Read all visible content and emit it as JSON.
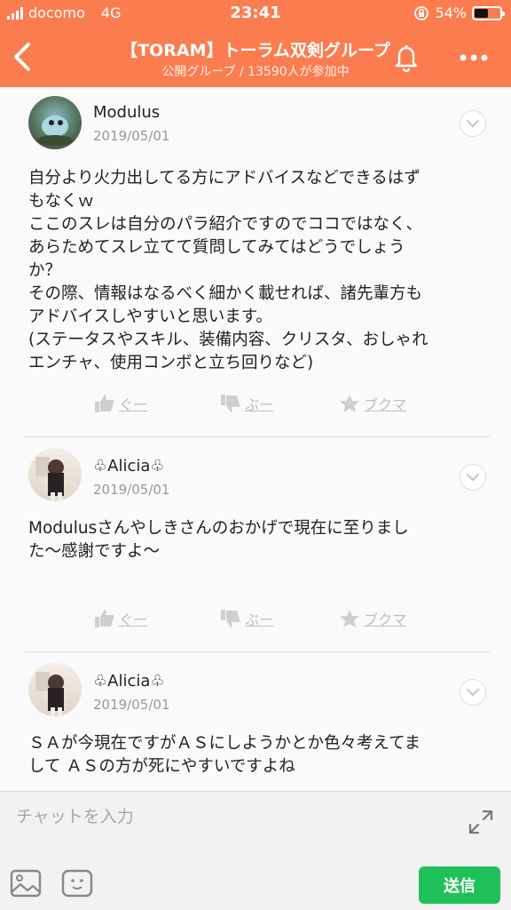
{
  "status_bar": {
    "carrier": "docomo",
    "network": "4G",
    "time": "23:41",
    "battery": "54%",
    "battery_level": 0.54
  },
  "header": {
    "title": "【TORAM】トーラム双剣グループ",
    "subtitle": "公開グループ / 13590人が参加中",
    "icons": {
      "back": "chevron-left-icon",
      "bell": "bell-icon",
      "more": "more-dots-icon"
    }
  },
  "posts": [
    {
      "username": "Modulus",
      "date": "2019/05/01",
      "body": "自分より火力出してる方にアドバイスなどできるはず\nもなくｗ\nここのスレは自分のパラ紹介ですのでココではなく、\nあらためてスレ立てて質問してみてはどうでしょう\nか？\nその際、情報はなるべく細かく載せれば、諸先輩方も\nアドバイスしやすいと思います。\n(ステータスやスキル、装備内容、クリスタ、おしゃれ\nエンチャ、使用コンボと立ち回りなど)"
    },
    {
      "username": "♧Alicia♧",
      "date": "2019/05/01",
      "body": "Modulusさんやしきさんのおかげで現在に至りまし\nた〜感謝ですよ〜"
    },
    {
      "username": "♧Alicia♧",
      "date": "2019/05/01",
      "body": "ＳＡが今現在ですがＡＳにしようかとか色々考えてま\nして ＡＳの方が死にやすいですよね"
    }
  ],
  "actions": {
    "like": "ぐー",
    "dislike": "ぶー",
    "bookmark": "ブクマ"
  },
  "composer": {
    "placeholder": "チャットを入力",
    "send_label": "送信"
  },
  "colors": {
    "header_bg": "#fb7d4f",
    "send_bg": "#21c15a"
  }
}
